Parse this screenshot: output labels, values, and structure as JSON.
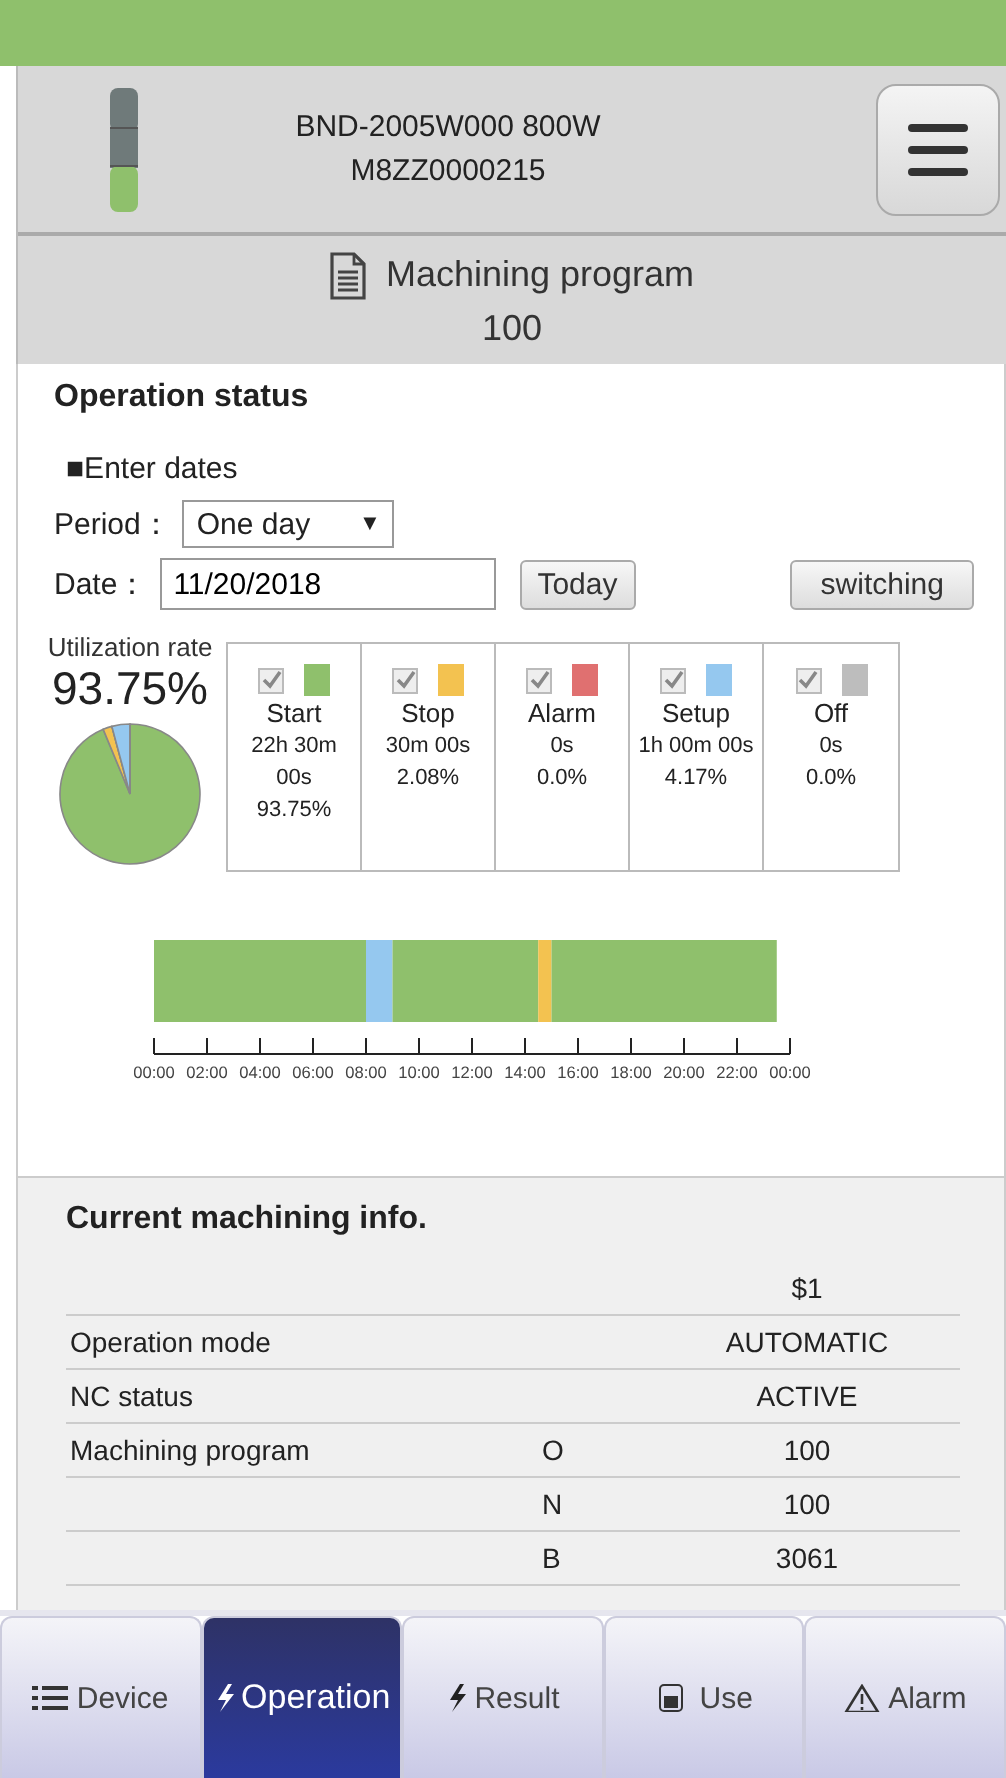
{
  "header": {
    "model": "BND-2005W000 800W",
    "serial": "M8ZZ0000215"
  },
  "program_banner": {
    "label": "Machining program",
    "number": "100"
  },
  "operation_status": {
    "title": "Operation status",
    "enter_dates": "■Enter dates",
    "period_label": "Period：",
    "period_value": "One day",
    "dropdown_arrow": "▼",
    "date_label": "Date：",
    "date_value": "11/20/2018",
    "today_button": "Today",
    "switch_button": "switching",
    "utilization_label": "Utilization rate",
    "utilization_value": "93.75%",
    "legend": [
      {
        "name": "Start",
        "time": "22h 30m 00s",
        "percent": "93.75%",
        "checked": true,
        "color": "#8fc06c"
      },
      {
        "name": "Stop",
        "time": "30m 00s",
        "percent": "2.08%",
        "checked": true,
        "color": "#f3c250"
      },
      {
        "name": "Alarm",
        "time": "0s",
        "percent": "0.0%",
        "checked": true,
        "color": "#e07070"
      },
      {
        "name": "Setup",
        "time": "1h 00m 00s",
        "percent": "4.17%",
        "checked": true,
        "color": "#95c8ef"
      },
      {
        "name": "Off",
        "time": "0s",
        "percent": "0.0%",
        "checked": true,
        "color": "#bdbdbd"
      }
    ],
    "timeline": {
      "chart_data": {
        "type": "bar",
        "orientation": "horizontal",
        "stacked": true,
        "xlim": [
          0,
          24
        ],
        "series": [
          {
            "color": "#8fc06c",
            "values": [
              8
            ]
          },
          {
            "color": "#95c8ef",
            "values": [
              1
            ]
          },
          {
            "color": "#8fc06c",
            "values": [
              5.5
            ]
          },
          {
            "color": "#f3c250",
            "values": [
              0.5
            ]
          },
          {
            "color": "#8fc06c",
            "values": [
              8.5
            ]
          }
        ],
        "xticks": [
          {
            "value": 0,
            "label": "00:00"
          },
          {
            "value": 2,
            "label": "02:00"
          },
          {
            "value": 4,
            "label": "04:00"
          },
          {
            "value": 6,
            "label": "06:00"
          },
          {
            "value": 8,
            "label": "08:00"
          },
          {
            "value": 10,
            "label": "10:00"
          },
          {
            "value": 12,
            "label": "12:00"
          },
          {
            "value": 14,
            "label": "14:00"
          },
          {
            "value": 16,
            "label": "16:00"
          },
          {
            "value": 18,
            "label": "18:00"
          },
          {
            "value": 20,
            "label": "20:00"
          },
          {
            "value": 22,
            "label": "22:00"
          },
          {
            "value": 24,
            "label": "00:00"
          }
        ]
      }
    }
  },
  "machining_info": {
    "title": "Current machining info.",
    "column_header": "$1",
    "rows": [
      {
        "label": "Operation mode",
        "value": "AUTOMATIC"
      },
      {
        "label": "NC status",
        "value": "ACTIVE"
      },
      {
        "label": "Machining program",
        "key": "O",
        "value": "100"
      },
      {
        "key": "N",
        "value": "100"
      },
      {
        "key": "B",
        "value": "3061"
      }
    ]
  },
  "tabs": [
    {
      "label": "Device",
      "kind": "list",
      "selected": false
    },
    {
      "label": "Operation",
      "kind": "bolt",
      "selected": true
    },
    {
      "label": "Result",
      "kind": "bolt",
      "selected": false
    },
    {
      "label": "Use",
      "kind": "meter",
      "selected": false
    },
    {
      "label": "Alarm",
      "kind": "warning",
      "selected": false
    }
  ]
}
